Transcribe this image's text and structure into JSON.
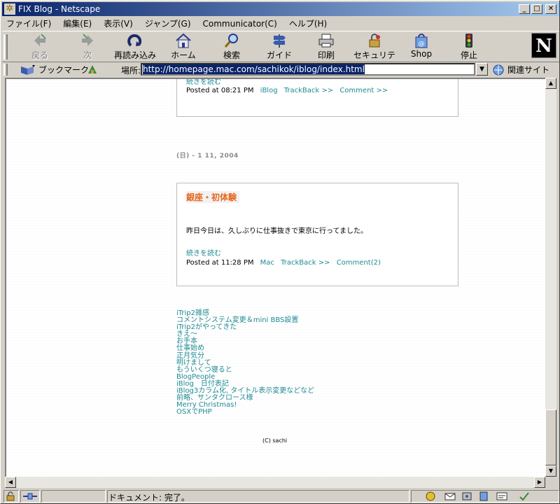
{
  "window": {
    "title": "FIX Blog - Netscape",
    "buttons": [
      "_",
      "□",
      "✕"
    ]
  },
  "menu": [
    "ファイル(F)",
    "編集(E)",
    "表示(V)",
    "ジャンプ(G)",
    "Communicator(C)",
    "ヘルプ(H)"
  ],
  "toolbar": {
    "back": "戻る",
    "forward": "次",
    "reload": "再読み込み",
    "home": "ホーム",
    "search": "検索",
    "guide": "ガイド",
    "print": "印刷",
    "security": "セキュリティ",
    "shop": "Shop",
    "stop": "停止",
    "logo": "N"
  },
  "location": {
    "bookmarks": "ブックマーク",
    "label": "場所:",
    "url": "http://homepage.mac.com/sachikok/iblog/index.html",
    "related": "関連サイト"
  },
  "post1": {
    "readmore": "続きを読む",
    "posted": "Posted at 08:21 PM",
    "category": "iBlog",
    "trackback": "TrackBack >>",
    "comment": "Comment >>"
  },
  "date_header": "(日) - 1 11, 2004",
  "post2": {
    "title": "銀座・初体験",
    "body": "昨日今日は、久しぶりに仕事抜きで東京に行ってました。",
    "readmore": "続きを読む",
    "posted": "Posted at 11:28 PM",
    "category": "Mac",
    "trackback": "TrackBack >>",
    "comment": "Comment(2)"
  },
  "recent_entries": [
    "iTrip2雑感",
    "コメントシステム変更＆mini BBS設置",
    "iTrip2がやってきた",
    "きえ～",
    "お手本",
    "仕事始め",
    "正月気分",
    "明けまして",
    "もういくつ寝ると",
    "BlogPeople",
    "iBlog　日付表記",
    "iBlog3カラム化, タイトル表示変更などなど",
    "前略、サンタクロース様",
    "Merry Christmas!",
    "OSXでPHP"
  ],
  "copyright": "(C) sachi",
  "status": {
    "text": "ドキュメント: 完了。"
  },
  "colors": {
    "link": "#1f8a94",
    "title_orange": "#e8661c",
    "selection": "#0a246a"
  }
}
